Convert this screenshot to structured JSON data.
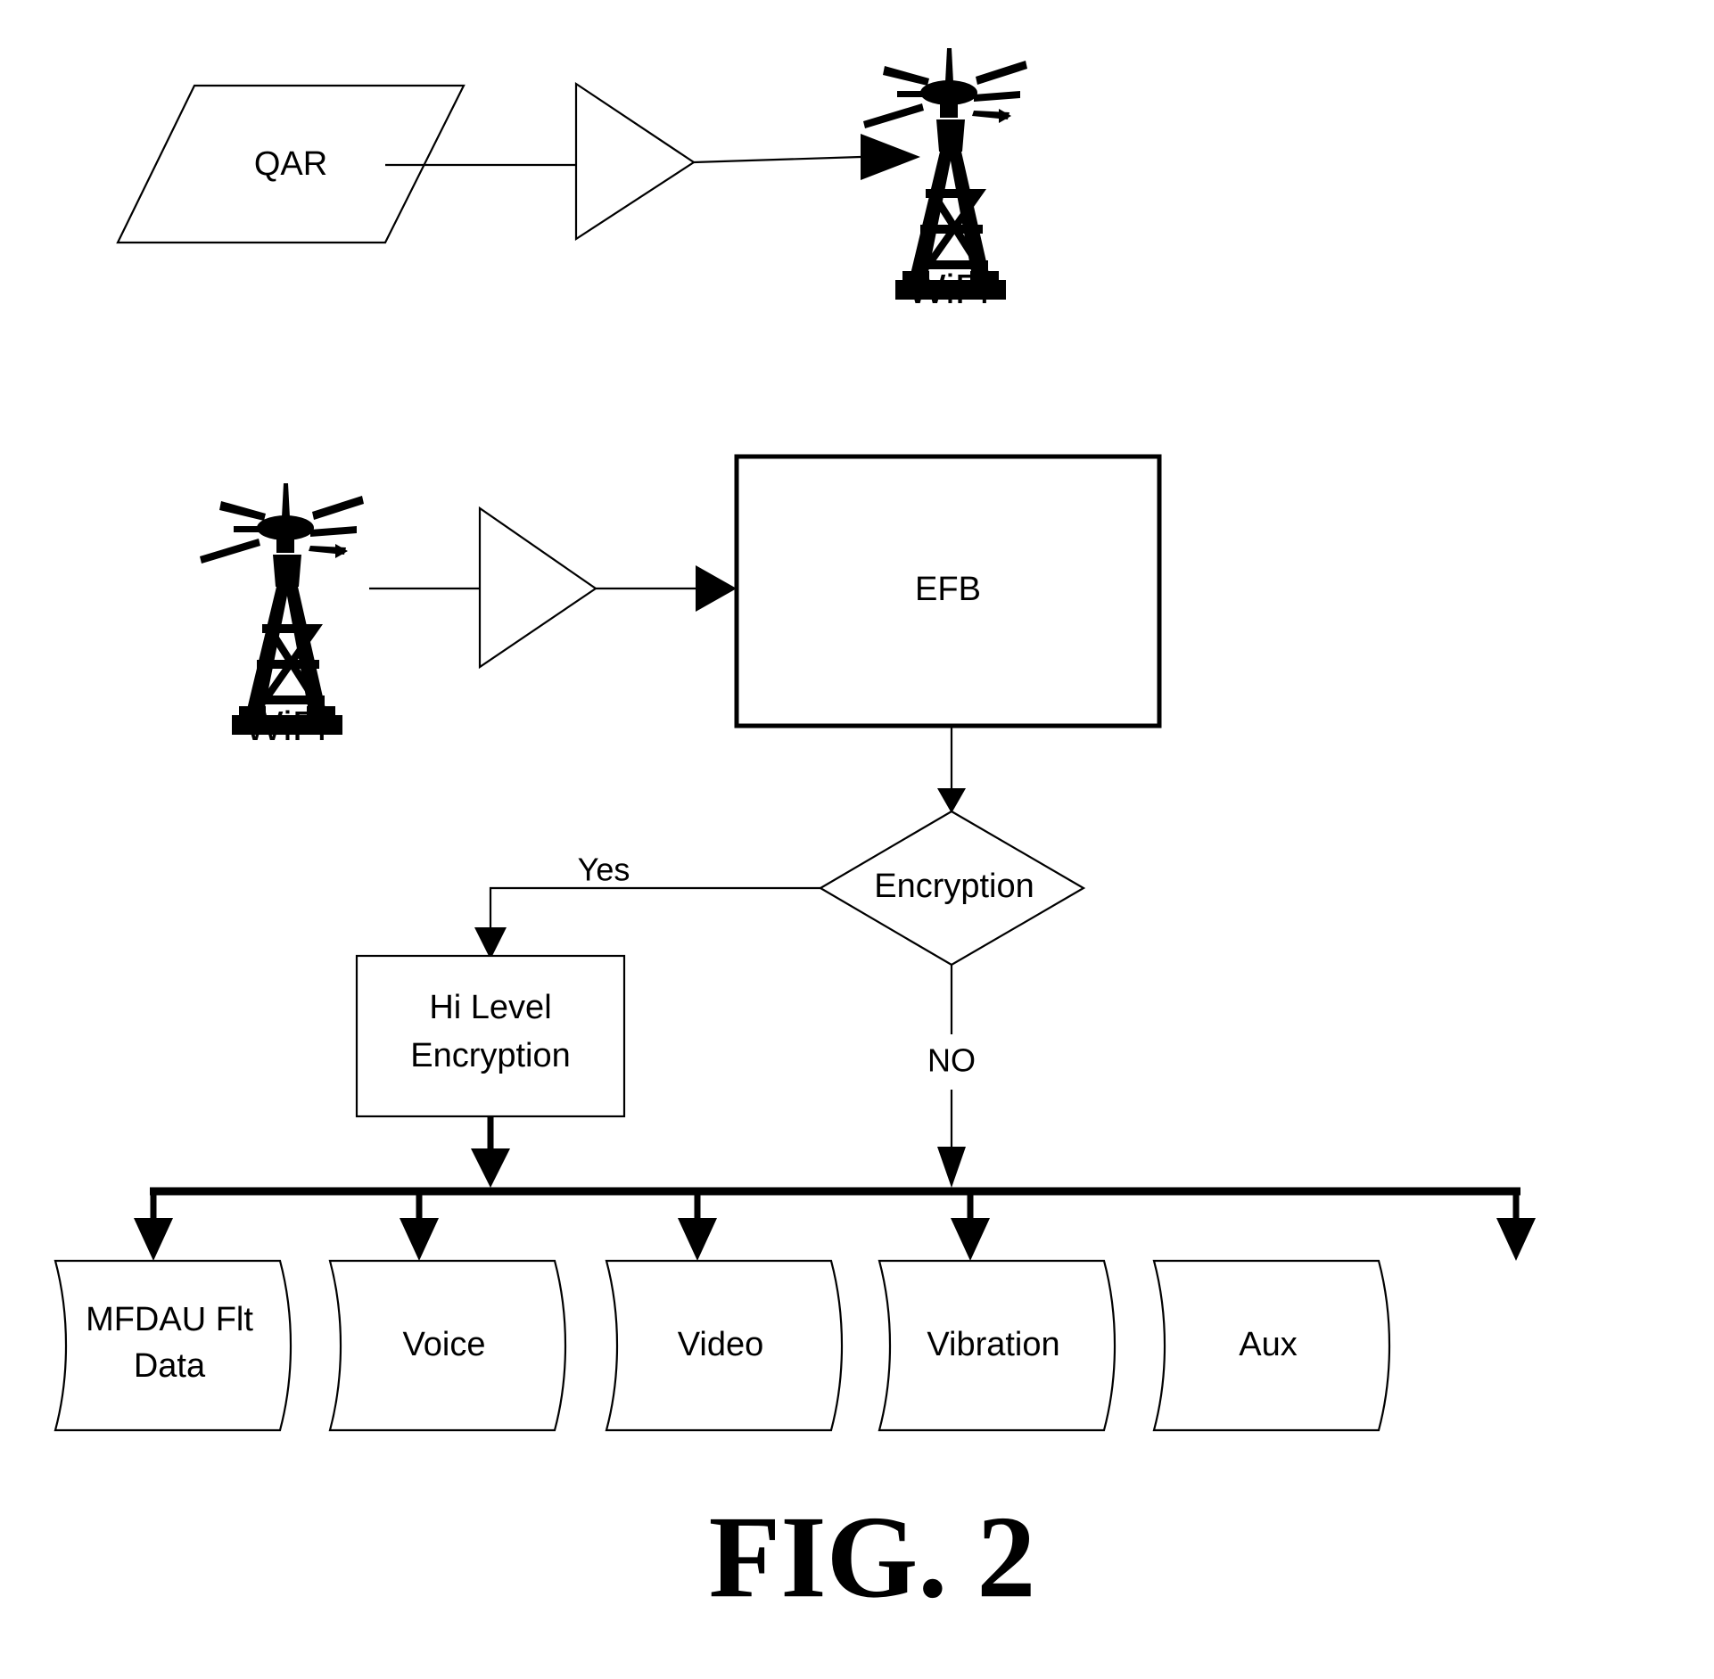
{
  "figure": {
    "caption": "FIG. 2",
    "caption_font_style": "bold-serif",
    "background_color": "#ffffff",
    "line_color": "#000000"
  },
  "top_section": {
    "source_node": {
      "label": "QAR",
      "shape": "parallelogram"
    },
    "amplifier": {
      "shape": "triangle-right",
      "label": ""
    },
    "destination_icon": {
      "caption": "WiFi",
      "icon": "radio-tower-icon"
    }
  },
  "middle_section": {
    "source_icon": {
      "caption": "WiFi",
      "icon": "radio-tower-icon"
    },
    "amplifier": {
      "shape": "triangle-right",
      "label": ""
    },
    "process_node": {
      "label": "EFB",
      "shape": "rectangle"
    }
  },
  "decision": {
    "label": "Encryption",
    "shape": "diamond",
    "yes_branch_label": "Yes",
    "no_branch_label": "NO"
  },
  "encryption_node": {
    "label_line1": "Hi Level",
    "label_line2": "Encryption",
    "shape": "rectangle"
  },
  "outputs": {
    "shape": "wavy-document",
    "items": [
      {
        "label_line1": "MFDAU Flt",
        "label_line2": "Data"
      },
      {
        "label_line1": "Voice",
        "label_line2": ""
      },
      {
        "label_line1": "Video",
        "label_line2": ""
      },
      {
        "label_line1": "Vibration",
        "label_line2": ""
      },
      {
        "label_line1": "Aux",
        "label_line2": ""
      }
    ]
  }
}
